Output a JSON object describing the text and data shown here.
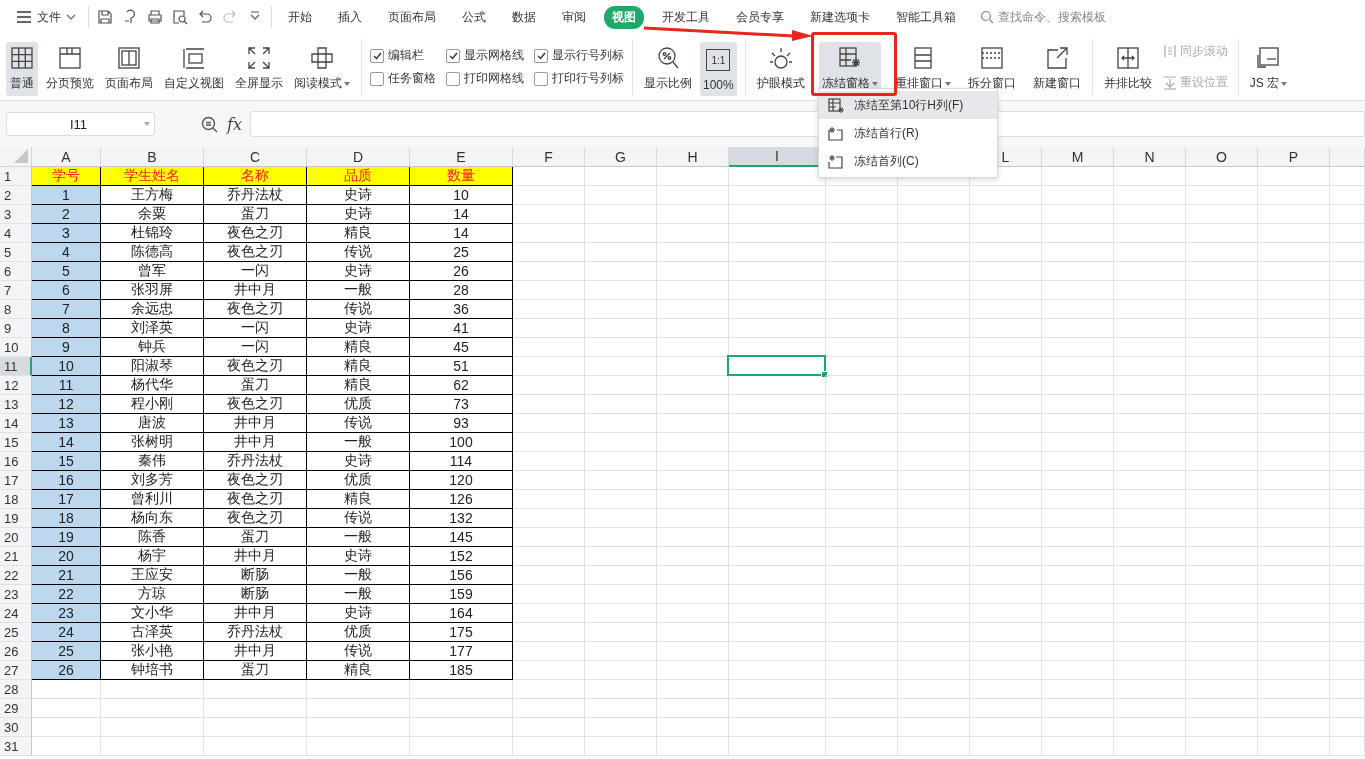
{
  "menu": {
    "label": "文件"
  },
  "quick_access": [
    {
      "disabled": false
    },
    {
      "disabled": false
    },
    {
      "disabled": false
    },
    {
      "disabled": false
    },
    {
      "disabled": false
    },
    {
      "disabled": true
    },
    {
      "disabled": false
    }
  ],
  "tabs": [
    {
      "label": "开始",
      "selected": false
    },
    {
      "label": "插入",
      "selected": false
    },
    {
      "label": "页面布局",
      "selected": false
    },
    {
      "label": "公式",
      "selected": false
    },
    {
      "label": "数据",
      "selected": false
    },
    {
      "label": "审阅",
      "selected": false
    },
    {
      "label": "视图",
      "selected": true
    },
    {
      "label": "开发工具",
      "selected": false
    },
    {
      "label": "会员专享",
      "selected": false
    },
    {
      "label": "新建选项卡",
      "selected": false
    },
    {
      "label": "智能工具箱",
      "selected": false
    }
  ],
  "search": {
    "placeholder": "查找命令、搜索模板"
  },
  "ribbon": [
    {
      "items": [
        {
          "kind": "large",
          "label": "普通",
          "selected": true,
          "dropdown": false
        },
        {
          "kind": "large",
          "label": "分页预览",
          "selected": false,
          "dropdown": false
        },
        {
          "kind": "large",
          "label": "页面布局",
          "selected": false,
          "dropdown": false
        },
        {
          "kind": "large",
          "label": "自定义视图",
          "selected": false,
          "dropdown": false
        },
        {
          "kind": "large",
          "label": "全屏显示",
          "selected": false,
          "dropdown": false
        },
        {
          "kind": "large",
          "label": "阅读模式",
          "selected": false,
          "dropdown": true
        }
      ]
    },
    {
      "items": [
        {
          "kind": "checkbox",
          "label": "编辑栏",
          "checked": true
        },
        {
          "kind": "checkbox",
          "label": "显示网格线",
          "checked": true
        },
        {
          "kind": "checkbox",
          "label": "显示行号列标",
          "checked": true
        },
        {
          "kind": "checkbox",
          "label": "任务窗格",
          "checked": false
        },
        {
          "kind": "checkbox",
          "label": "打印网格线",
          "checked": false
        },
        {
          "kind": "checkbox",
          "label": "打印行号列标",
          "checked": false
        }
      ]
    },
    {
      "items": [
        {
          "kind": "large",
          "label": "显示比例",
          "selected": false,
          "dropdown": false
        },
        {
          "kind": "large",
          "label": "100%",
          "badge": "1:1",
          "selected": true,
          "dropdown": false
        }
      ]
    },
    {
      "items": [
        {
          "kind": "large",
          "label": "护眼模式",
          "selected": false,
          "dropdown": false
        },
        {
          "kind": "large",
          "label": "冻结窗格",
          "selected": true,
          "dropdown": true
        },
        {
          "kind": "large",
          "label": "重排窗口",
          "selected": false,
          "dropdown": true
        },
        {
          "kind": "large",
          "label": "拆分窗口",
          "selected": false,
          "dropdown": false
        },
        {
          "kind": "large",
          "label": "新建窗口",
          "selected": false,
          "dropdown": false
        }
      ]
    },
    {
      "items": [
        {
          "kind": "large",
          "label": "并排比较",
          "selected": false,
          "dropdown": false
        },
        {
          "kind": "small",
          "label": "同步滚动",
          "disabled": true
        },
        {
          "kind": "small",
          "label": "重设位置",
          "disabled": true
        }
      ]
    },
    {
      "items": [
        {
          "kind": "large",
          "label": "JS 宏",
          "selected": false,
          "dropdown": true
        }
      ]
    }
  ],
  "freeze_menu": {
    "items": [
      {
        "label": "冻结至第10行H列(F)",
        "selected": true
      },
      {
        "label": "冻结首行(R)",
        "selected": false
      },
      {
        "label": "冻结首列(C)",
        "selected": false
      }
    ]
  },
  "formula_bar": {
    "name_box": "I11",
    "function_label": "fx"
  },
  "columns": [
    {
      "letter": "A",
      "selected": false
    },
    {
      "letter": "B",
      "selected": false
    },
    {
      "letter": "C",
      "selected": false
    },
    {
      "letter": "D",
      "selected": false
    },
    {
      "letter": "E",
      "selected": false
    },
    {
      "letter": "F",
      "selected": false
    },
    {
      "letter": "G",
      "selected": false
    },
    {
      "letter": "H",
      "selected": false
    },
    {
      "letter": "I",
      "selected": true
    },
    {},
    {},
    {
      "letter": "L",
      "selected": false
    },
    {
      "letter": "M",
      "selected": false
    },
    {
      "letter": "N",
      "selected": false
    },
    {
      "letter": "O",
      "selected": false
    },
    {
      "letter": "P",
      "selected": false
    }
  ],
  "rows": [
    {
      "number": "1",
      "kind": "header",
      "selected": false,
      "cells": [
        "学号",
        "学生姓名",
        "名称",
        "品质",
        "数量"
      ]
    },
    {
      "number": "2",
      "kind": "data",
      "selected": false,
      "cells": [
        "1",
        "王方梅",
        "乔丹法杖",
        "史诗",
        "10"
      ]
    },
    {
      "number": "3",
      "kind": "data",
      "selected": false,
      "cells": [
        "2",
        "余粟",
        "蛋刀",
        "史诗",
        "14"
      ]
    },
    {
      "number": "4",
      "kind": "data",
      "selected": false,
      "cells": [
        "3",
        "杜锦玲",
        "夜色之刃",
        "精良",
        "14"
      ]
    },
    {
      "number": "5",
      "kind": "data",
      "selected": false,
      "cells": [
        "4",
        "陈德高",
        "夜色之刃",
        "传说",
        "25"
      ]
    },
    {
      "number": "6",
      "kind": "data",
      "selected": false,
      "cells": [
        "5",
        "曾军",
        "一闪",
        "史诗",
        "26"
      ]
    },
    {
      "number": "7",
      "kind": "data",
      "selected": false,
      "cells": [
        "6",
        "张羽屏",
        "井中月",
        "一般",
        "28"
      ]
    },
    {
      "number": "8",
      "kind": "data",
      "selected": false,
      "cells": [
        "7",
        "余远忠",
        "夜色之刃",
        "传说",
        "36"
      ]
    },
    {
      "number": "9",
      "kind": "data",
      "selected": false,
      "cells": [
        "8",
        "刘泽英",
        "一闪",
        "史诗",
        "41"
      ]
    },
    {
      "number": "10",
      "kind": "data",
      "selected": false,
      "cells": [
        "9",
        "钟兵",
        "一闪",
        "精良",
        "45"
      ]
    },
    {
      "number": "11",
      "kind": "data",
      "selected": true,
      "cells": [
        "10",
        "阳淑琴",
        "夜色之刃",
        "精良",
        "51"
      ]
    },
    {
      "number": "12",
      "kind": "data",
      "selected": false,
      "cells": [
        "11",
        "杨代华",
        "蛋刀",
        "精良",
        "62"
      ]
    },
    {
      "number": "13",
      "kind": "data",
      "selected": false,
      "cells": [
        "12",
        "程小刚",
        "夜色之刃",
        "优质",
        "73"
      ]
    },
    {
      "number": "14",
      "kind": "data",
      "selected": false,
      "cells": [
        "13",
        "唐波",
        "井中月",
        "传说",
        "93"
      ]
    },
    {
      "number": "15",
      "kind": "data",
      "selected": false,
      "cells": [
        "14",
        "张树明",
        "井中月",
        "一般",
        "100"
      ]
    },
    {
      "number": "16",
      "kind": "data",
      "selected": false,
      "cells": [
        "15",
        "秦伟",
        "乔丹法杖",
        "史诗",
        "114"
      ]
    },
    {
      "number": "17",
      "kind": "data",
      "selected": false,
      "cells": [
        "16",
        "刘多芳",
        "夜色之刃",
        "优质",
        "120"
      ]
    },
    {
      "number": "18",
      "kind": "data",
      "selected": false,
      "cells": [
        "17",
        "曾利川",
        "夜色之刃",
        "精良",
        "126"
      ]
    },
    {
      "number": "19",
      "kind": "data",
      "selected": false,
      "cells": [
        "18",
        "杨向东",
        "夜色之刃",
        "传说",
        "132"
      ]
    },
    {
      "number": "20",
      "kind": "data",
      "selected": false,
      "cells": [
        "19",
        "陈香",
        "蛋刀",
        "一般",
        "145"
      ]
    },
    {
      "number": "21",
      "kind": "data",
      "selected": false,
      "cells": [
        "20",
        "杨宇",
        "井中月",
        "史诗",
        "152"
      ]
    },
    {
      "number": "22",
      "kind": "data",
      "selected": false,
      "cells": [
        "21",
        "王应安",
        "断肠",
        "一般",
        "156"
      ]
    },
    {
      "number": "23",
      "kind": "data",
      "selected": false,
      "cells": [
        "22",
        "方琼",
        "断肠",
        "一般",
        "159"
      ]
    },
    {
      "number": "24",
      "kind": "data",
      "selected": false,
      "cells": [
        "23",
        "文小华",
        "井中月",
        "史诗",
        "164"
      ]
    },
    {
      "number": "25",
      "kind": "data",
      "selected": false,
      "cells": [
        "24",
        "古泽英",
        "乔丹法杖",
        "优质",
        "175"
      ]
    },
    {
      "number": "26",
      "kind": "data",
      "selected": false,
      "cells": [
        "25",
        "张小艳",
        "井中月",
        "传说",
        "177"
      ]
    },
    {
      "number": "27",
      "kind": "data",
      "selected": false,
      "cells": [
        "26",
        "钟培书",
        "蛋刀",
        "精良",
        "185"
      ]
    },
    {
      "number": "28",
      "kind": "empty",
      "selected": false
    },
    {
      "number": "29",
      "kind": "empty",
      "selected": false
    },
    {
      "number": "30",
      "kind": "empty",
      "selected": false
    },
    {
      "number": "31",
      "kind": "empty",
      "selected": false
    }
  ]
}
